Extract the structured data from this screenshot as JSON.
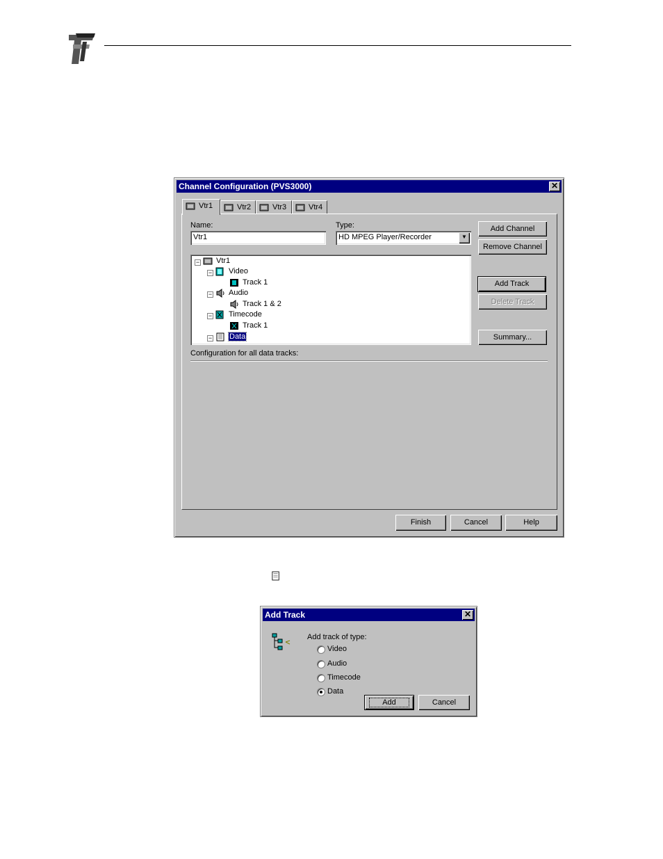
{
  "channel_dialog": {
    "title": "Channel Configuration (PVS3000)",
    "tabs": [
      {
        "label": "Vtr1",
        "active": true
      },
      {
        "label": "Vtr2",
        "active": false
      },
      {
        "label": "Vtr3",
        "active": false
      },
      {
        "label": "Vtr4",
        "active": false
      }
    ],
    "name_label": "Name:",
    "name_value": "Vtr1",
    "type_label": "Type:",
    "type_value": "HD MPEG Player/Recorder",
    "tree": {
      "root": "Vtr1",
      "video": "Video",
      "video_track": "Track 1",
      "audio": "Audio",
      "audio_track": "Track 1 & 2",
      "timecode": "Timecode",
      "timecode_track": "Track 1",
      "data": "Data"
    },
    "buttons": {
      "add_channel": "Add Channel",
      "remove_channel": "Remove Channel",
      "add_track": "Add Track",
      "delete_track": "Delete Track",
      "summary": "Summary..."
    },
    "config_label": "Configuration for all data tracks:",
    "footer": {
      "finish": "Finish",
      "cancel": "Cancel",
      "help": "Help"
    }
  },
  "add_track_dialog": {
    "title": "Add Track",
    "prompt": "Add track of type:",
    "options": [
      "Video",
      "Audio",
      "Timecode",
      "Data"
    ],
    "selected": "Data",
    "add": "Add",
    "cancel": "Cancel"
  },
  "colors": {
    "title_bar": "#000080",
    "face": "#c0c0c0",
    "selection": "#000080"
  }
}
